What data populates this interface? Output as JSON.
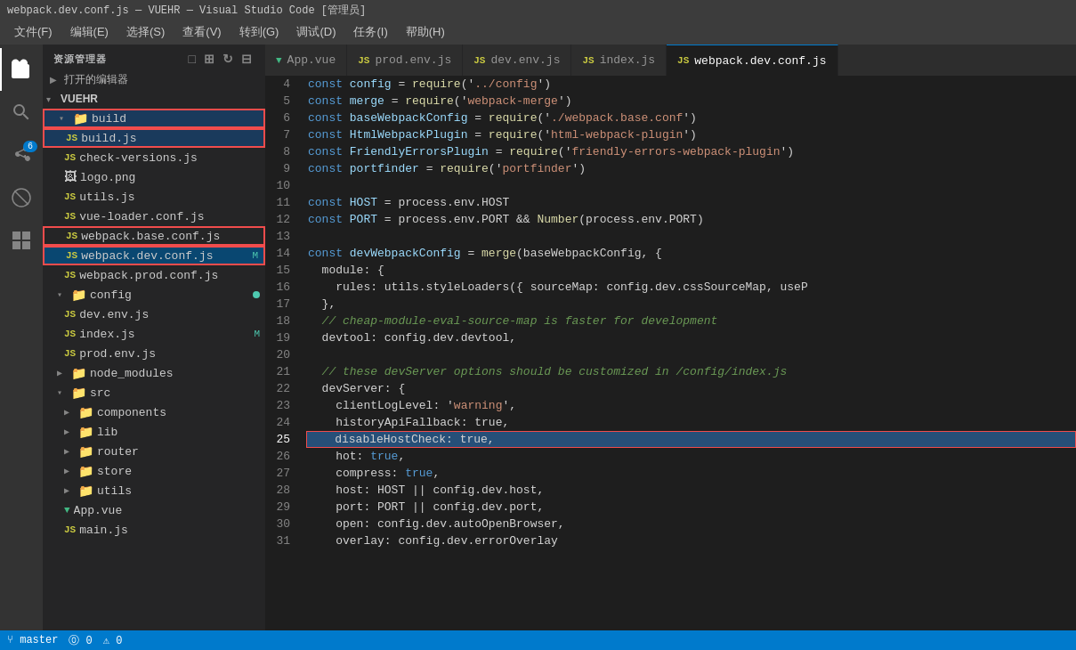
{
  "titlebar": {
    "text": "webpack.dev.conf.js — VUEHR — Visual Studio Code [管理员]"
  },
  "menubar": {
    "items": [
      "文件(F)",
      "编辑(E)",
      "选择(S)",
      "查看(V)",
      "转到(G)",
      "调试(D)",
      "任务(I)",
      "帮助(H)"
    ]
  },
  "sidebar": {
    "header": "资源管理器",
    "open_editors_label": "打开的编辑器",
    "root_folder": "VUEHR",
    "tree": [
      {
        "label": "build",
        "type": "folder",
        "indent": 1,
        "arrow": "▾",
        "highlight": true
      },
      {
        "label": "build.js",
        "type": "js",
        "indent": 2,
        "highlight": false
      },
      {
        "label": "check-versions.js",
        "type": "js",
        "indent": 2
      },
      {
        "label": "logo.png",
        "type": "img",
        "indent": 2
      },
      {
        "label": "utils.js",
        "type": "js",
        "indent": 2
      },
      {
        "label": "vue-loader.conf.js",
        "type": "js",
        "indent": 2
      },
      {
        "label": "webpack.base.conf.js",
        "type": "js",
        "indent": 2,
        "highlight_box": true
      },
      {
        "label": "webpack.dev.conf.js",
        "type": "js",
        "indent": 2,
        "highlight_box": true,
        "modified": "M"
      },
      {
        "label": "webpack.prod.conf.js",
        "type": "js",
        "indent": 2
      },
      {
        "label": "config",
        "type": "folder",
        "indent": 1,
        "arrow": "▾",
        "dot": true
      },
      {
        "label": "dev.env.js",
        "type": "js",
        "indent": 2
      },
      {
        "label": "index.js",
        "type": "js",
        "indent": 2,
        "modified": "M"
      },
      {
        "label": "prod.env.js",
        "type": "js",
        "indent": 2
      },
      {
        "label": "node_modules",
        "type": "folder",
        "indent": 1,
        "arrow": "▶"
      },
      {
        "label": "src",
        "type": "folder",
        "indent": 1,
        "arrow": "▾"
      },
      {
        "label": "components",
        "type": "folder",
        "indent": 2,
        "arrow": "▶"
      },
      {
        "label": "lib",
        "type": "folder",
        "indent": 2,
        "arrow": "▶"
      },
      {
        "label": "router",
        "type": "folder",
        "indent": 2,
        "arrow": "▶"
      },
      {
        "label": "store",
        "type": "folder",
        "indent": 2,
        "arrow": "▶"
      },
      {
        "label": "utils",
        "type": "folder",
        "indent": 2,
        "arrow": "▶"
      },
      {
        "label": "App.vue",
        "type": "vue",
        "indent": 2
      },
      {
        "label": "main.js",
        "type": "js",
        "indent": 2
      }
    ]
  },
  "tabs": [
    {
      "label": "App.vue",
      "type": "vue",
      "active": false
    },
    {
      "label": "prod.env.js",
      "type": "js",
      "active": false
    },
    {
      "label": "dev.env.js",
      "type": "js",
      "active": false
    },
    {
      "label": "index.js",
      "type": "js",
      "active": false
    },
    {
      "label": "webpack.dev.conf.js",
      "type": "js",
      "active": true
    }
  ],
  "code": {
    "lines": [
      {
        "num": 4,
        "tokens": [
          {
            "t": "const ",
            "c": "c-keyword"
          },
          {
            "t": "config",
            "c": "c-var"
          },
          {
            "t": " = ",
            "c": "c-plain"
          },
          {
            "t": "require",
            "c": "c-func"
          },
          {
            "t": "('",
            "c": "c-plain"
          },
          {
            "t": "../config",
            "c": "c-string"
          },
          {
            "t": "')",
            "c": "c-plain"
          }
        ]
      },
      {
        "num": 5,
        "tokens": [
          {
            "t": "const ",
            "c": "c-keyword"
          },
          {
            "t": "merge",
            "c": "c-var"
          },
          {
            "t": " = ",
            "c": "c-plain"
          },
          {
            "t": "require",
            "c": "c-func"
          },
          {
            "t": "('",
            "c": "c-plain"
          },
          {
            "t": "webpack-merge",
            "c": "c-string"
          },
          {
            "t": "')",
            "c": "c-plain"
          }
        ]
      },
      {
        "num": 6,
        "tokens": [
          {
            "t": "const ",
            "c": "c-keyword"
          },
          {
            "t": "baseWebpackConfig",
            "c": "c-var"
          },
          {
            "t": " = ",
            "c": "c-plain"
          },
          {
            "t": "require",
            "c": "c-func"
          },
          {
            "t": "('",
            "c": "c-plain"
          },
          {
            "t": "./webpack.base.conf",
            "c": "c-string"
          },
          {
            "t": "')",
            "c": "c-plain"
          }
        ]
      },
      {
        "num": 7,
        "tokens": [
          {
            "t": "const ",
            "c": "c-keyword"
          },
          {
            "t": "HtmlWebpackPlugin",
            "c": "c-var"
          },
          {
            "t": " = ",
            "c": "c-plain"
          },
          {
            "t": "require",
            "c": "c-func"
          },
          {
            "t": "('",
            "c": "c-plain"
          },
          {
            "t": "html-webpack-plugin",
            "c": "c-string"
          },
          {
            "t": "')",
            "c": "c-plain"
          }
        ]
      },
      {
        "num": 8,
        "tokens": [
          {
            "t": "const ",
            "c": "c-keyword"
          },
          {
            "t": "FriendlyErrorsPlugin",
            "c": "c-var"
          },
          {
            "t": " = ",
            "c": "c-plain"
          },
          {
            "t": "require",
            "c": "c-func"
          },
          {
            "t": "('",
            "c": "c-plain"
          },
          {
            "t": "friendly-errors-webpack-plugin",
            "c": "c-string"
          },
          {
            "t": "')",
            "c": "c-plain"
          }
        ]
      },
      {
        "num": 9,
        "tokens": [
          {
            "t": "const ",
            "c": "c-keyword"
          },
          {
            "t": "portfinder",
            "c": "c-var"
          },
          {
            "t": " = ",
            "c": "c-plain"
          },
          {
            "t": "require",
            "c": "c-func"
          },
          {
            "t": "('",
            "c": "c-plain"
          },
          {
            "t": "portfinder",
            "c": "c-string"
          },
          {
            "t": "')",
            "c": "c-plain"
          }
        ]
      },
      {
        "num": 10,
        "tokens": []
      },
      {
        "num": 11,
        "tokens": [
          {
            "t": "const ",
            "c": "c-keyword"
          },
          {
            "t": "HOST",
            "c": "c-var"
          },
          {
            "t": " = process.env.HOST",
            "c": "c-plain"
          }
        ]
      },
      {
        "num": 12,
        "tokens": [
          {
            "t": "const ",
            "c": "c-keyword"
          },
          {
            "t": "PORT",
            "c": "c-var"
          },
          {
            "t": " = process.env.PORT && ",
            "c": "c-plain"
          },
          {
            "t": "Number",
            "c": "c-func"
          },
          {
            "t": "(process.env.PORT)",
            "c": "c-plain"
          }
        ]
      },
      {
        "num": 13,
        "tokens": []
      },
      {
        "num": 14,
        "tokens": [
          {
            "t": "const ",
            "c": "c-keyword"
          },
          {
            "t": "devWebpackConfig",
            "c": "c-var"
          },
          {
            "t": " = ",
            "c": "c-plain"
          },
          {
            "t": "merge",
            "c": "c-func"
          },
          {
            "t": "(baseWebpackConfig, {",
            "c": "c-plain"
          }
        ]
      },
      {
        "num": 15,
        "tokens": [
          {
            "t": "  module: {",
            "c": "c-plain"
          }
        ]
      },
      {
        "num": 16,
        "tokens": [
          {
            "t": "    rules: utils.styleLoaders({ sourceMap: config.dev.cssSourceMap, useP",
            "c": "c-plain"
          }
        ]
      },
      {
        "num": 17,
        "tokens": [
          {
            "t": "  },",
            "c": "c-plain"
          }
        ]
      },
      {
        "num": 18,
        "tokens": [
          {
            "t": "  ",
            "c": "c-plain"
          },
          {
            "t": "// cheap-module-eval-source-map is faster for development",
            "c": "c-comment"
          }
        ]
      },
      {
        "num": 19,
        "tokens": [
          {
            "t": "  devtool: config.dev.devtool,",
            "c": "c-plain"
          }
        ]
      },
      {
        "num": 20,
        "tokens": []
      },
      {
        "num": 21,
        "tokens": [
          {
            "t": "  ",
            "c": "c-plain"
          },
          {
            "t": "// these devServer options should be customized in /config/index.js",
            "c": "c-comment"
          }
        ]
      },
      {
        "num": 22,
        "tokens": [
          {
            "t": "  devServer: {",
            "c": "c-plain"
          }
        ]
      },
      {
        "num": 23,
        "tokens": [
          {
            "t": "    clientLogLevel: '",
            "c": "c-plain"
          },
          {
            "t": "warning",
            "c": "c-string"
          },
          {
            "t": "',",
            "c": "c-plain"
          }
        ]
      },
      {
        "num": 24,
        "tokens": [
          {
            "t": "    historyApiFallback: true,",
            "c": "c-plain"
          }
        ]
      },
      {
        "num": 25,
        "tokens": [
          {
            "t": "    disableHostCheck: true,",
            "c": "c-plain"
          }
        ],
        "highlighted": true
      },
      {
        "num": 26,
        "tokens": [
          {
            "t": "    hot: ",
            "c": "c-plain"
          },
          {
            "t": "true",
            "c": "c-true"
          },
          {
            "t": ",",
            "c": "c-plain"
          }
        ]
      },
      {
        "num": 27,
        "tokens": [
          {
            "t": "    compress: ",
            "c": "c-plain"
          },
          {
            "t": "true",
            "c": "c-true"
          },
          {
            "t": ",",
            "c": "c-plain"
          }
        ]
      },
      {
        "num": 28,
        "tokens": [
          {
            "t": "    host: HOST || config.dev.host,",
            "c": "c-plain"
          }
        ]
      },
      {
        "num": 29,
        "tokens": [
          {
            "t": "    port: PORT || config.dev.port,",
            "c": "c-plain"
          }
        ]
      },
      {
        "num": 30,
        "tokens": [
          {
            "t": "    open: config.dev.autoOpenBrowser,",
            "c": "c-plain"
          }
        ]
      },
      {
        "num": 31,
        "tokens": [
          {
            "t": "    overlay: config.dev.errorOverlay",
            "c": "c-plain"
          }
        ]
      }
    ]
  },
  "statusbar": {
    "branch": "master",
    "errors": "⓪ 0",
    "warnings": "⚠ 0"
  }
}
